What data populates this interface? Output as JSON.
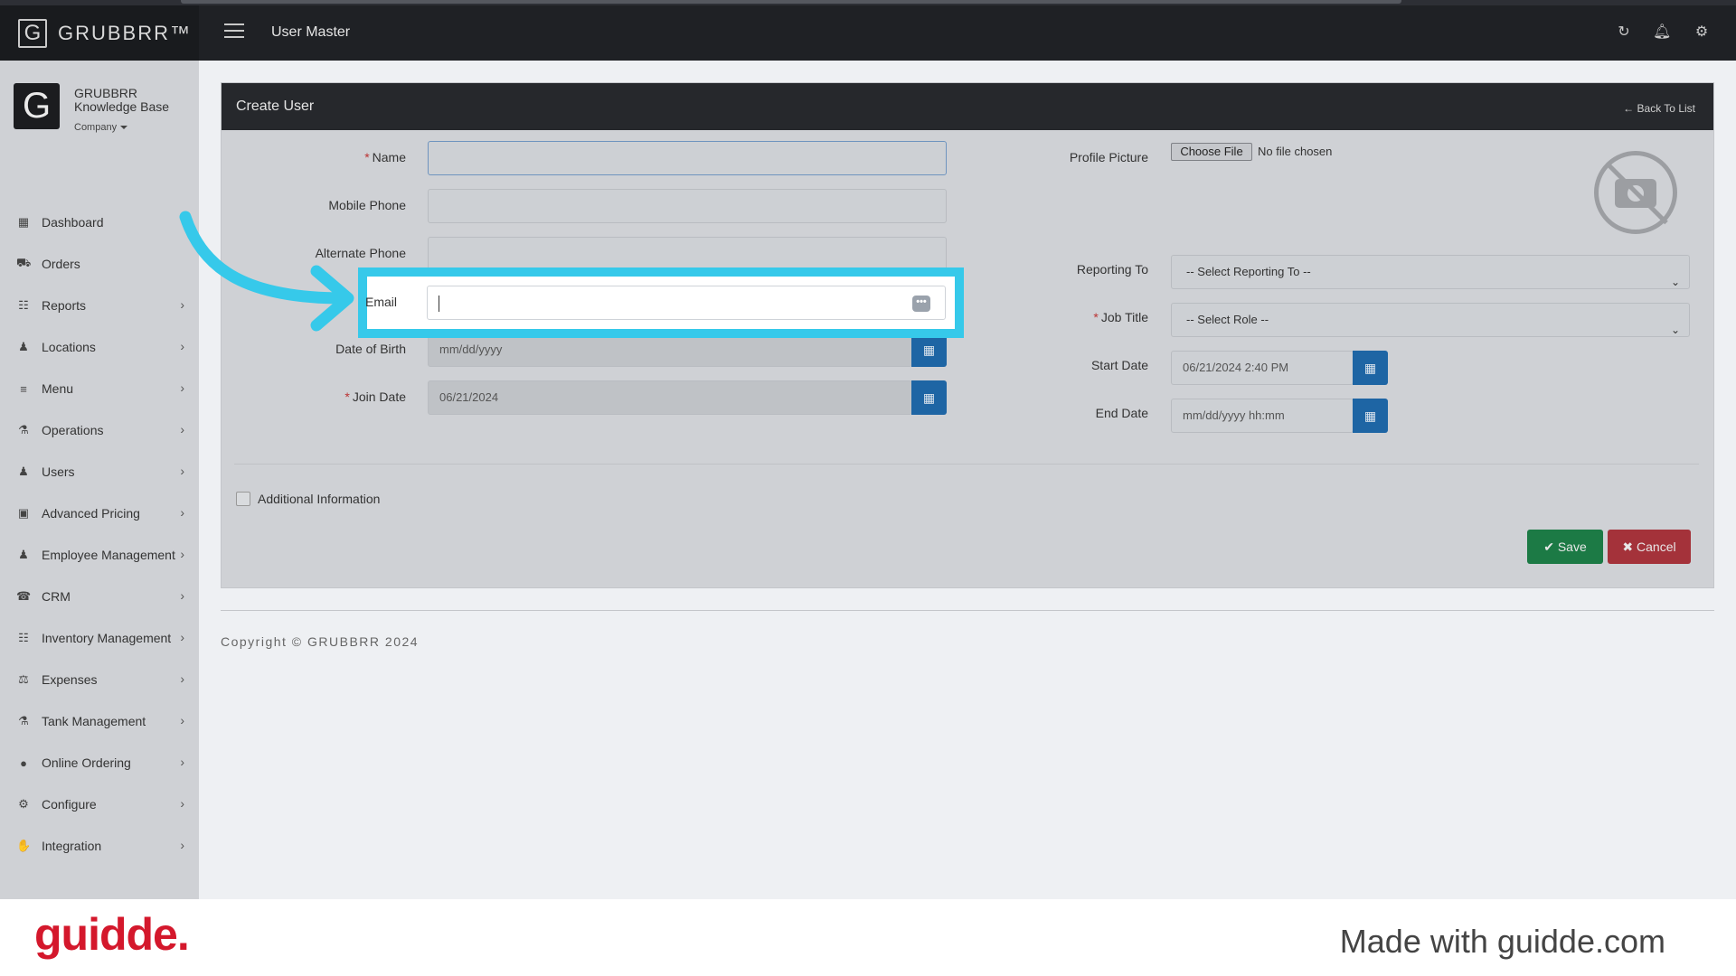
{
  "app": {
    "logo_letter": "G",
    "logo_text": "GRUBBRR™",
    "page_title": "User Master"
  },
  "header_icons": [
    "refresh-icon",
    "bell-icon",
    "gear-icon"
  ],
  "sidebar": {
    "avatar_letter": "G",
    "profile_name": "GRUBBRR Knowledge Base",
    "company_label": "Company",
    "items": [
      {
        "label": "Dashboard",
        "icon": "▦",
        "has_children": false
      },
      {
        "label": "Orders",
        "icon": "⛟",
        "has_children": false
      },
      {
        "label": "Reports",
        "icon": "☷",
        "has_children": true
      },
      {
        "label": "Locations",
        "icon": "♟",
        "has_children": true
      },
      {
        "label": "Menu",
        "icon": "≡",
        "has_children": true
      },
      {
        "label": "Operations",
        "icon": "⚗",
        "has_children": true
      },
      {
        "label": "Users",
        "icon": "♟",
        "has_children": true
      },
      {
        "label": "Advanced Pricing",
        "icon": "▣",
        "has_children": true
      },
      {
        "label": "Employee Management",
        "icon": "♟",
        "has_children": true
      },
      {
        "label": "CRM",
        "icon": "☎",
        "has_children": true
      },
      {
        "label": "Inventory Management",
        "icon": "☷",
        "has_children": true
      },
      {
        "label": "Expenses",
        "icon": "⚖",
        "has_children": true
      },
      {
        "label": "Tank Management",
        "icon": "⚗",
        "has_children": true
      },
      {
        "label": "Online Ordering",
        "icon": "●",
        "has_children": true
      },
      {
        "label": "Configure",
        "icon": "⚙",
        "has_children": true
      },
      {
        "label": "Integration",
        "icon": "✋",
        "has_children": true
      }
    ]
  },
  "panel": {
    "title": "Create User",
    "back_link": "Back To List",
    "fields": {
      "name_label": "Name",
      "mobile_label": "Mobile Phone",
      "alternate_label": "Alternate Phone",
      "email_label": "Email",
      "email_value": "",
      "dob_label": "Date of Birth",
      "dob_placeholder": "mm/dd/yyyy",
      "join_label": "Join Date",
      "join_value": "06/21/2024",
      "profile_label": "Profile Picture",
      "file_button": "Choose File",
      "file_status": "No file chosen",
      "reporting_label": "Reporting To",
      "reporting_value": "-- Select Reporting To --",
      "job_label": "Job Title",
      "job_value": "-- Select Role --",
      "start_label": "Start Date",
      "start_value": "06/21/2024 2:40 PM",
      "end_label": "End Date",
      "end_placeholder": "mm/dd/yyyy hh:mm"
    },
    "additional_info": "Additional Information",
    "save": "Save",
    "cancel": "Cancel"
  },
  "footer": {
    "copyright": "Copyright © GRUBBRR 2024"
  },
  "guidde": {
    "logo": "guidde.",
    "made_with": "Made with guidde.com"
  },
  "colors": {
    "highlight": "#36c9ea",
    "save": "#1c7a45",
    "cancel": "#a4323a",
    "calendar": "#1e65a4",
    "guidde_red": "#d4182c"
  }
}
